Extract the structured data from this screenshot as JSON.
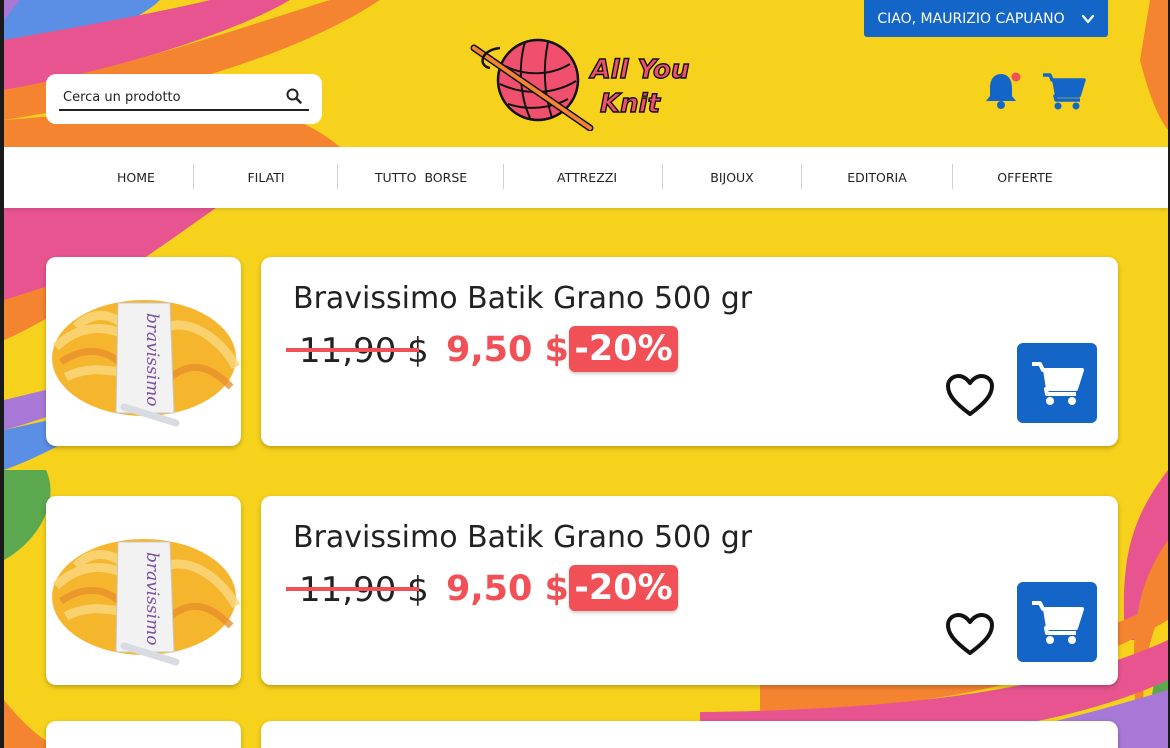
{
  "header": {
    "user_greeting": "CIAO, MAURIZIO CAPUANO",
    "search_placeholder": "Cerca un prodotto",
    "logo_text_line1": "All You",
    "logo_text_line2": "Knit"
  },
  "nav": {
    "items": [
      {
        "label": "HOME"
      },
      {
        "label": "FILATI"
      },
      {
        "label": "TUTTO  BORSE"
      },
      {
        "label": "ATTREZZI"
      },
      {
        "label": "BIJOUX"
      },
      {
        "label": "EDITORIA"
      },
      {
        "label": "OFFERTE"
      }
    ]
  },
  "products": [
    {
      "title": "Bravissimo Batik Grano 500 gr",
      "old_price": "11,90 $",
      "new_price": "9,50 $",
      "discount": "-20%",
      "ball_label": "bravissimo"
    },
    {
      "title": "Bravissimo Batik Grano 500 gr",
      "old_price": "11,90 $",
      "new_price": "9,50 $",
      "discount": "-20%",
      "ball_label": "bravissimo"
    }
  ],
  "colors": {
    "background": "#f6d21c",
    "primary_blue": "#1366c7",
    "sale_red": "#f25057",
    "logo_pink": "#f0506e",
    "notification_dot": "#f25057"
  },
  "icons": {
    "search": "search-icon",
    "bell": "bell-icon",
    "cart": "cart-icon",
    "heart": "heart-outline-icon",
    "chevron": "chevron-down-icon"
  }
}
